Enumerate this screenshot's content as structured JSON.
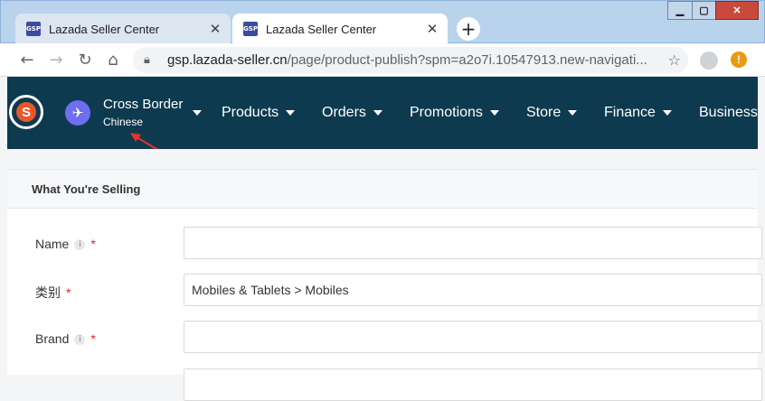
{
  "browser": {
    "tabs": [
      {
        "favicon": "GSP",
        "title": "Lazada Seller Center",
        "active": false
      },
      {
        "favicon": "GSP",
        "title": "Lazada Seller Center",
        "active": true
      }
    ],
    "url_domain": "gsp.lazada-seller.cn",
    "url_path": "/page/product-publish?spm=a2o7i.10547913.new-navigati..."
  },
  "navbar": {
    "region_title": "Cross Border",
    "region_sub": "Chinese",
    "menu": [
      "Products",
      "Orders",
      "Promotions",
      "Store",
      "Finance",
      "Business"
    ]
  },
  "form": {
    "section_title": "What You're Selling",
    "fields": [
      {
        "label": "Name",
        "value": "",
        "info": true,
        "required": true
      },
      {
        "label": "类别",
        "value": "Mobiles & Tablets > Mobiles",
        "info": false,
        "required": true
      },
      {
        "label": "Brand",
        "value": "",
        "info": true,
        "required": true
      }
    ]
  },
  "colors": {
    "navbar_bg": "#0e3a4f",
    "accent_purple": "#6f6df0",
    "required_red": "#e0202f",
    "arrow_red": "#e8322b"
  },
  "icons": [
    "lazada-logo-icon",
    "plane-icon",
    "lock-icon",
    "star-icon",
    "back-icon",
    "forward-icon",
    "reload-icon",
    "home-icon"
  ]
}
